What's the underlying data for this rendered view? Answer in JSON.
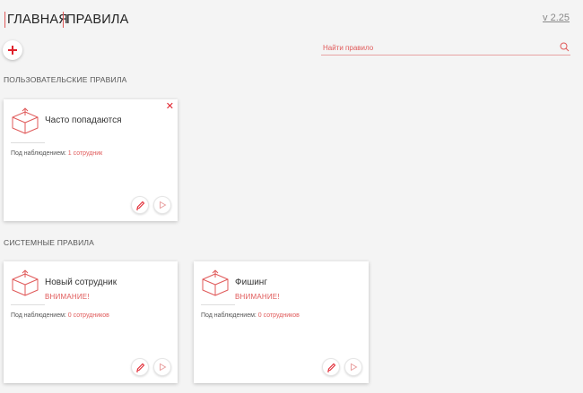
{
  "header": {
    "breadcrumb_home": "ГЛАВНАЯ",
    "breadcrumb_current": "ПРАВИЛА",
    "version": "v 2.25"
  },
  "toolbar": {
    "add_icon": "plus-icon"
  },
  "search": {
    "placeholder": "Найти правило",
    "value": ""
  },
  "sections": {
    "user_rules": "ПОЛЬЗОВАТЕЛЬСКИЕ ПРАВИЛА",
    "system_rules": "СИСТЕМНЫЕ ПРАВИЛА"
  },
  "user_rules": [
    {
      "title": "Часто попадаются",
      "warning": "",
      "watch_label": "Под наблюдением:",
      "watch_count": "1 сотрудник",
      "closable": true
    }
  ],
  "system_rules": [
    {
      "title": "Новый сотрудник",
      "warning": "ВНИМАНИЕ!",
      "watch_label": "Под наблюдением:",
      "watch_count": "0 сотрудников"
    },
    {
      "title": "Фишинг",
      "warning": "ВНИМАНИЕ!",
      "watch_label": "Под наблюдением:",
      "watch_count": "0 сотрудников"
    }
  ],
  "colors": {
    "accent": "#e05a5a",
    "close": "#e0212c",
    "background": "#f4f4f4"
  }
}
